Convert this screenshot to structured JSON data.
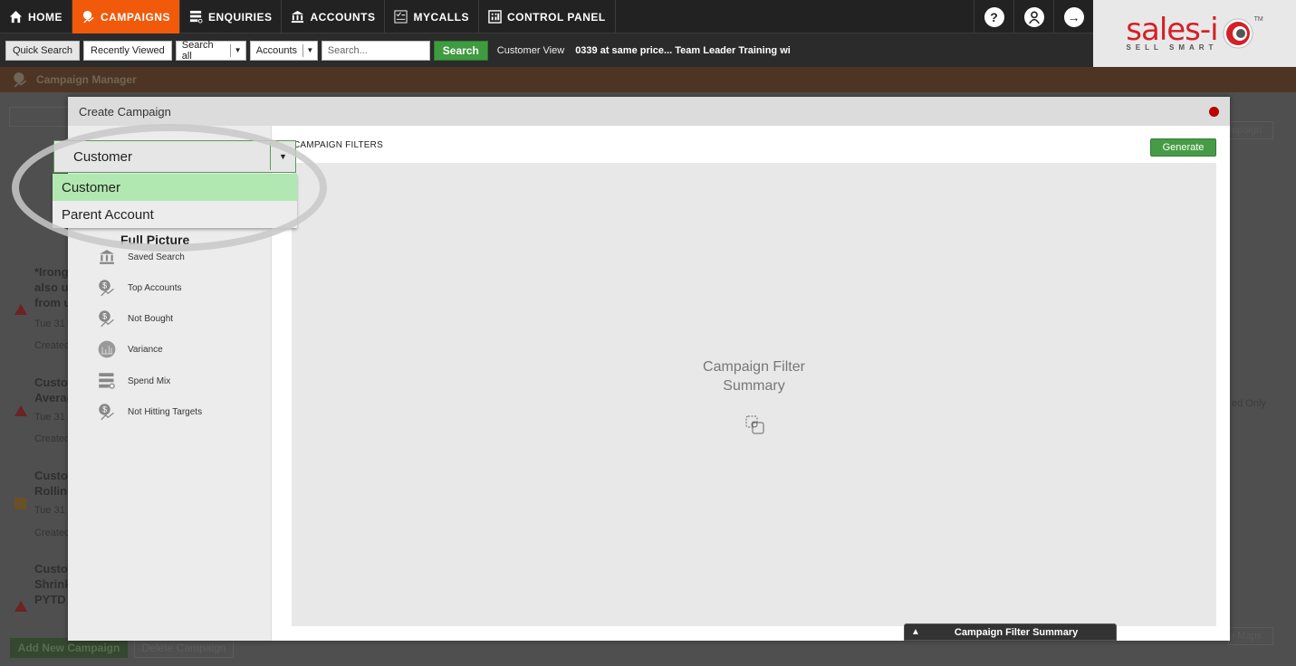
{
  "nav": {
    "items": [
      {
        "label": "HOME",
        "icon": "home-icon",
        "active": false
      },
      {
        "label": "CAMPAIGNS",
        "icon": "campaign-icon",
        "active": true
      },
      {
        "label": "ENQUIRIES",
        "icon": "enquiries-icon",
        "active": false
      },
      {
        "label": "ACCOUNTS",
        "icon": "bank-icon",
        "active": false
      },
      {
        "label": "MYCALLS",
        "icon": "checklist-icon",
        "active": false
      },
      {
        "label": "CONTROL PANEL",
        "icon": "grid-icon",
        "active": false
      }
    ],
    "help_glyph": "?",
    "logout_glyph": "→"
  },
  "searchbar": {
    "quick_search": "Quick Search",
    "recently_viewed": "Recently Viewed",
    "scope_select": "Search all",
    "type_select": "Accounts",
    "search_placeholder": "Search...",
    "search_button": "Search",
    "customer_view": "Customer View",
    "recent_items": "0339 at same price... Team Leader Training wi"
  },
  "logo": {
    "main": "sales-i",
    "tagline": "SELL SMART",
    "tm": "TM"
  },
  "page": {
    "title": "Campaign Manager"
  },
  "background": {
    "campaigns": [
      {
        "lines": [
          "*Irong",
          "also us",
          "from u"
        ],
        "date": "Tue 31",
        "created": "Created",
        "status": "red"
      },
      {
        "lines": [
          "Custor",
          "Averag"
        ],
        "date": "Tue 31",
        "created": "Created",
        "status": "red"
      },
      {
        "lines": [
          "Custor",
          "Rolling"
        ],
        "date": "Tue 31",
        "created": "Created",
        "status": "amber"
      },
      {
        "lines": [
          "Custor",
          "Shrink",
          "PYTD -"
        ],
        "date": "",
        "created": "",
        "status": "red"
      }
    ],
    "add_button": "Add New Campaign",
    "delete_button": "Delete Campaign",
    "right_campaign_button": "mpaign",
    "right_filter_text": "ed Only",
    "right_maps_button": "e Maps"
  },
  "modal": {
    "title": "Create Campaign",
    "dropdown": {
      "selected": "Customer",
      "options": [
        "Customer",
        "Parent Account"
      ],
      "highlighted": "Customer"
    },
    "side": {
      "header": "Full Picture",
      "items": [
        {
          "label": "Saved Search",
          "icon": "bank-icon"
        },
        {
          "label": "Top Accounts",
          "icon": "dollar-trend-icon"
        },
        {
          "label": "Not Bought",
          "icon": "dollar-trend-icon"
        },
        {
          "label": "Variance",
          "icon": "chart-circle-icon"
        },
        {
          "label": "Spend Mix",
          "icon": "list-search-icon"
        },
        {
          "label": "Not Hitting Targets",
          "icon": "dollar-trend-icon"
        }
      ]
    },
    "filters_title": "CAMPAIGN FILTERS",
    "generate_button": "Generate",
    "summary_line1": "Campaign Filter",
    "summary_line2": "Summary",
    "summary_tab": "Campaign Filter Summary",
    "summary_tab_glyph": "▲"
  },
  "colors": {
    "accent_orange": "#f05a0a",
    "green": "#469c46",
    "close_red": "#bb0000",
    "dropdown_highlight": "#b1e8b1"
  }
}
